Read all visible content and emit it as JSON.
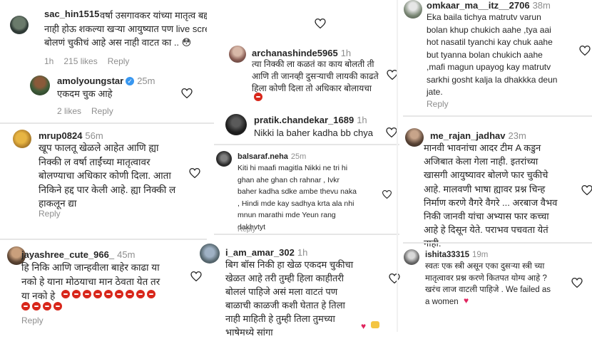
{
  "comments": [
    {
      "user": "sac_hin1515",
      "time": "",
      "text": "वर्षा उसगावकर यांच्या मातृत्व बद्दल बोलला गेलं .. त्या आई\nनाही होऊ शकल्या खऱ्या आयुष्यात पण live screen समोर त्याबद्दल\nबोलणं चुकीचं आहे अस नाही वाटत का .. 😳",
      "meta": [
        "1h",
        "215 likes",
        "Reply"
      ]
    },
    {
      "user": "amolyoungstar",
      "time": "25m",
      "text": "एकदम चुक आहे",
      "meta": [
        "2 likes",
        "Reply"
      ],
      "verified": true
    },
    {
      "user": "mrup0824",
      "time": "56m",
      "text": "खूप फालतू खेळले आहेत आणि ह्या\nनिक्की ल वर्षा ताईंच्या मातृत्वावर\nबोलण्याचा अधिकार कोणी दिला. आता\nनिकिने हद्द पार केली आहे. ह्या निक्की ल\nहाकलून द्या",
      "meta": [
        "Reply"
      ]
    },
    {
      "user": "jayashree_cute_966_",
      "time": "45m",
      "text": "हि निकि आणि जान्हवीला बाहेर काढा या\nनको हे याना मोठयाचा मान ठेवता येत तर\nया नको हे",
      "meta": [
        "Reply"
      ]
    },
    {
      "user": "archanashinde5965",
      "time": "1h",
      "text": "त्या निक्की ला कळतं का काय बोलती ती\nआणि ती जानव्ही दुसऱ्याची लायकी काढते\nहिला कोणी दिला तो अधिकार बोलायचा",
      "meta": []
    },
    {
      "user": "pratik.chandekar_1689",
      "time": "1h",
      "text": "Nikki la baher kadha bb chya",
      "meta": []
    },
    {
      "user": "balsaraf.neha",
      "time": "25m",
      "text": "Kiti hi maafi magitla Nikki ne tri hi\nghan ahe ghan ch rahnar , Ivkr\nbaher kadha sdke ambe thevu naka\n, Hindi mde kay sadhya krta ala nhi\nmnun marathi mde Yeun rang\ndakhvtyt",
      "meta": [
        "Reply"
      ]
    },
    {
      "user": "i_am_amar_302",
      "time": "1h",
      "text": "बिग बॉस निकी हा खेळ एकदम चुकीचा\nखेळत आहे तरी तुम्ही हिला काहीतरी\nबोललं पाहिजे असं मला वाटतं पण\nबाळाची काळजी कशी घेतात हे तिला\nनाही माहिती हे तुम्ही तिला तुमच्या\nभाषेमध्ये सांगा",
      "meta": [
        "Reply"
      ]
    },
    {
      "user": "omkaar_ma__itz__2706",
      "time": "38m",
      "text": "Eka baila tichya matrutv varun\nbolan khup chukich aahe ,tya aai\nhot nasatil tyanchi kay chuk aahe\nbut tyanna bolan chukich aahe\n,mafi magun upayog kay matrutv\nsarkhi gosht kalja la dhakkka deun\njate.",
      "meta": [
        "Reply"
      ]
    },
    {
      "user": "me_rajan_jadhav",
      "time": "23m",
      "text": "मानवी भावनांचा आदर टीम A कडुन\nअजिबात केला गेला नाही. इतरांच्या\nखासगी आयुष्यावर बोलणे फार चुकीचे\nआहे. मालवणी भाषा ह्यावर प्रश्न चिन्ह\nनिर्माण करणे वैगरे वैगरे ... अरबाज वैभव\nनिकी जानवी यांचा अभ्यास फार कच्चा\nआहे हे दिसून येते. पराभव पचवता येतं\nनाही.",
      "meta": []
    },
    {
      "user": "ishita33315",
      "time": "19m",
      "text": "स्वतः एक स्त्री असून एका दुसऱ्या स्त्री च्या\nमातृत्वावर प्रश्न करणे कितपत योग्य आहे ?\nखरंच लाज वाटली पाहिजे . We failed as\na women",
      "meta": []
    }
  ],
  "emoji": {
    "angry_count_row1": 9,
    "angry_count_row2": 4,
    "heart_blue": "💙",
    "heart_red": "♥️",
    "hands": "🙌",
    "broken_heart": "💔",
    "angry": "😡"
  },
  "icons": {
    "heart": "heart-icon",
    "verified": "verified-badge-icon"
  }
}
